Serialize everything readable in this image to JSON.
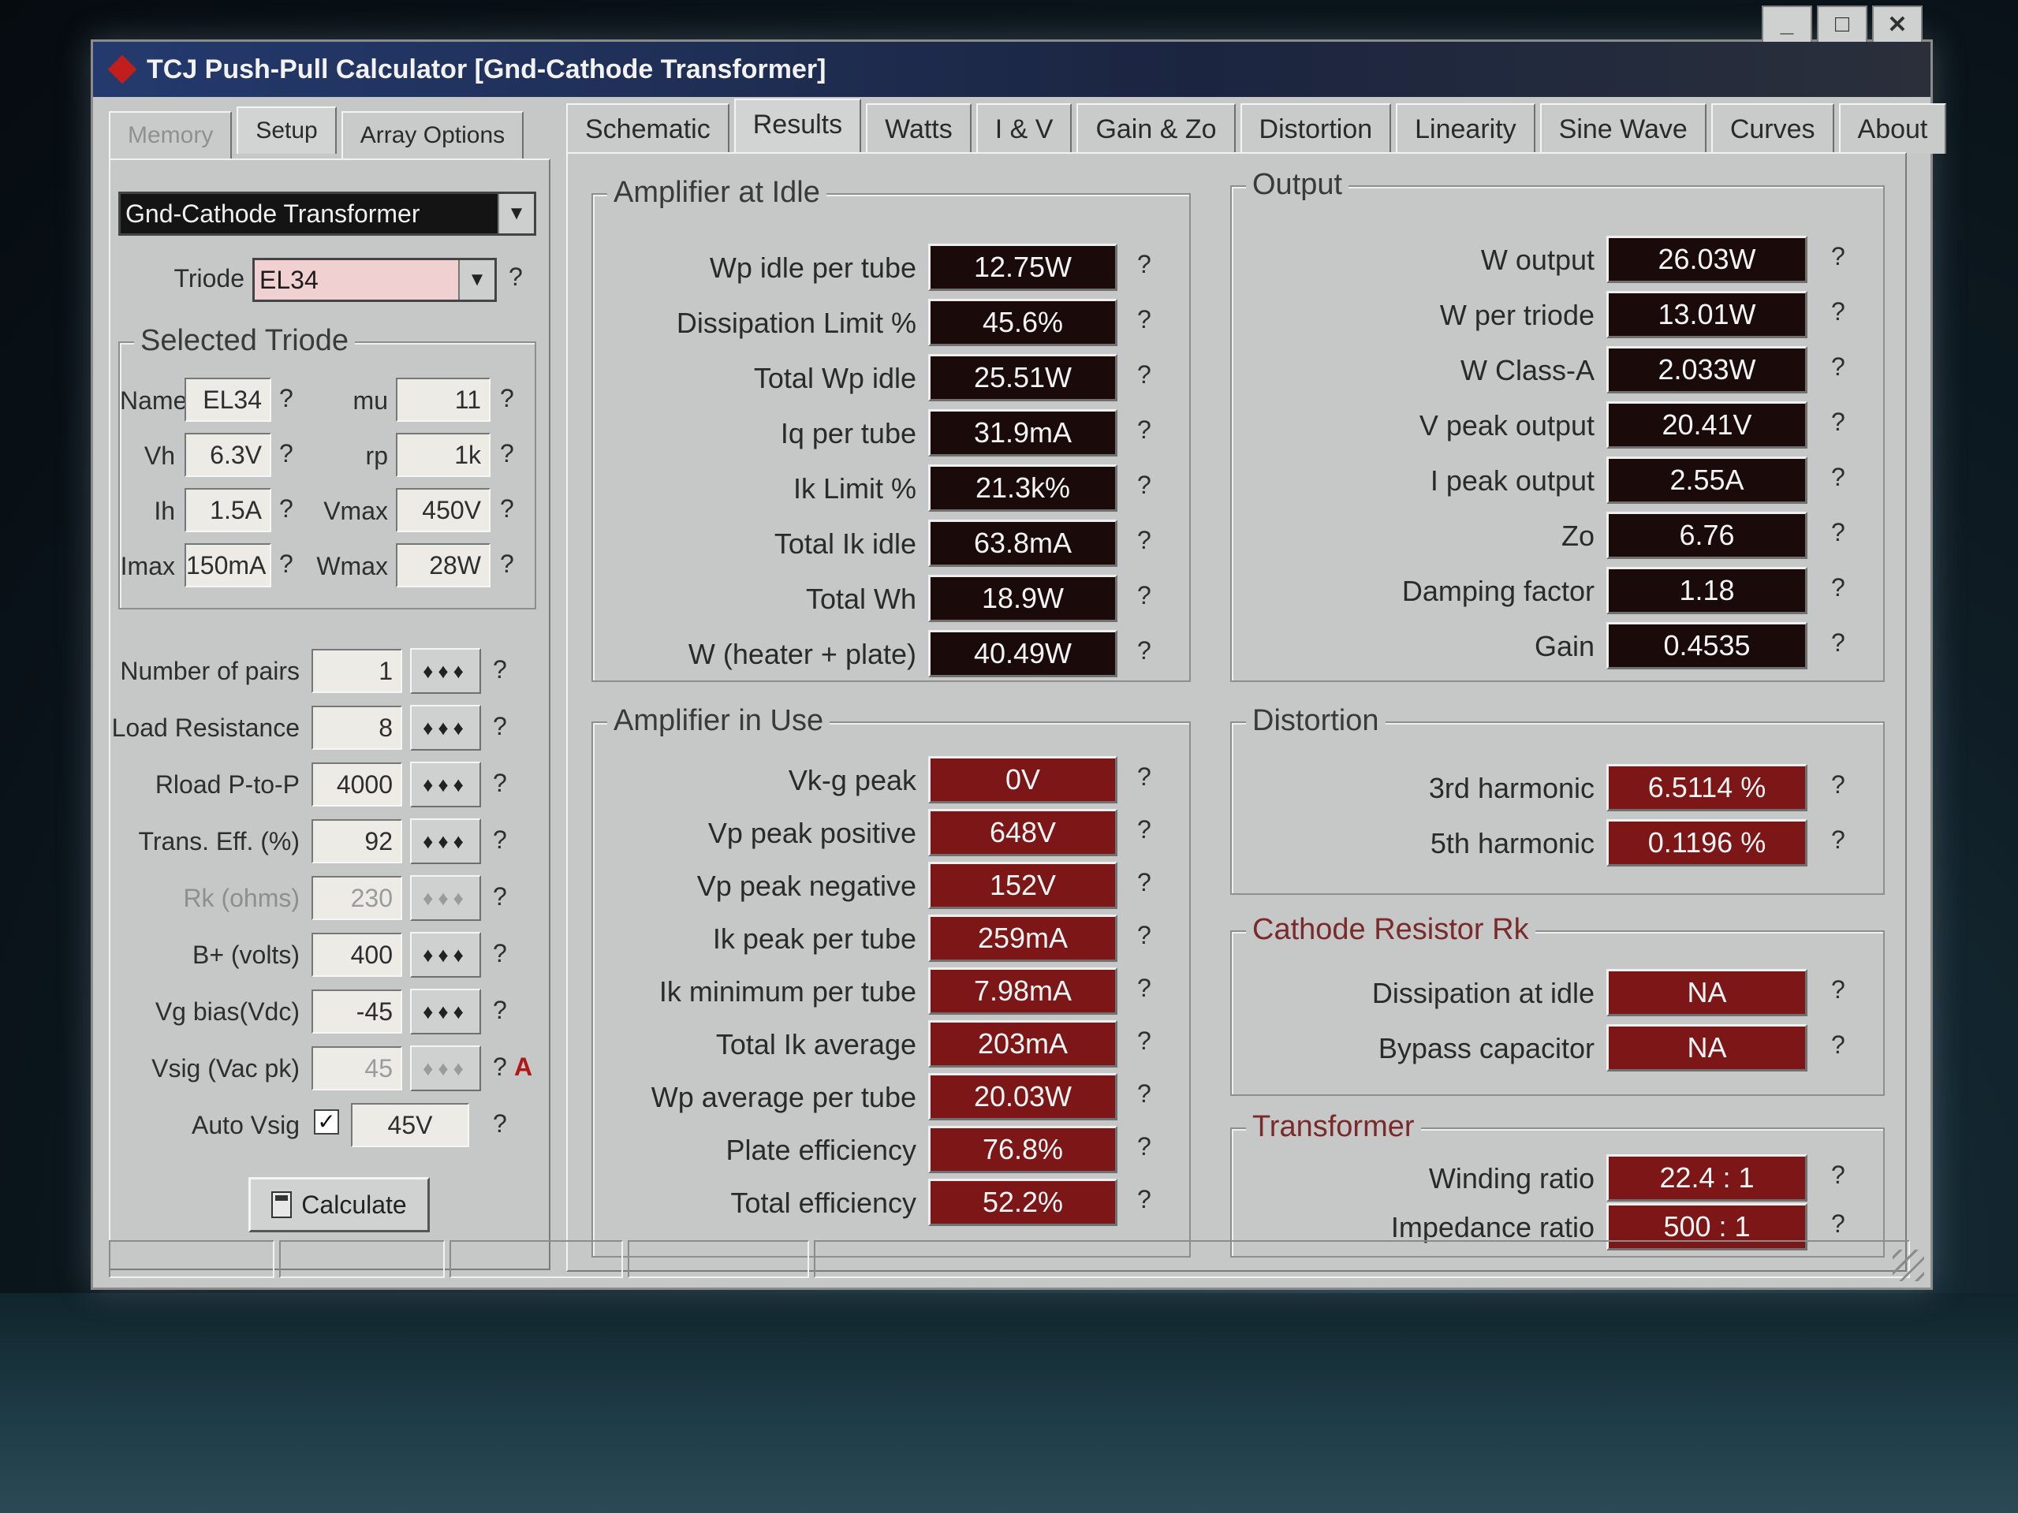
{
  "window": {
    "title": "TCJ Push-Pull Calculator [Gnd-Cathode Transformer]"
  },
  "left_tabs": [
    "Memory",
    "Setup",
    "Array Options"
  ],
  "right_tabs": [
    "Schematic",
    "Results",
    "Watts",
    "I & V",
    "Gain & Zo",
    "Distortion",
    "Linearity",
    "Sine Wave",
    "Curves",
    "About"
  ],
  "setup": {
    "topology": "Gnd-Cathode Transformer",
    "triode_label": "Triode",
    "triode": "EL34",
    "selected_triode": {
      "title": "Selected Triode",
      "name_label": "Name",
      "name": "EL34",
      "vh_label": "Vh",
      "vh": "6.3V",
      "ih_label": "Ih",
      "ih": "1.5A",
      "imax_label": "Imax",
      "imax": "150mA",
      "mu_label": "mu",
      "mu": "11",
      "rp_label": "rp",
      "rp": "1k",
      "vmax_label": "Vmax",
      "vmax": "450V",
      "wmax_label": "Wmax",
      "wmax": "28W"
    },
    "params": [
      {
        "label": "Number of pairs",
        "value": "1"
      },
      {
        "label": "Load Resistance",
        "value": "8"
      },
      {
        "label": "Rload P-to-P",
        "value": "4000"
      },
      {
        "label": "Trans. Eff. (%)",
        "value": "92"
      },
      {
        "label": "Rk (ohms)",
        "value": "230"
      },
      {
        "label": "B+ (volts)",
        "value": "400"
      },
      {
        "label": "Vg bias(Vdc)",
        "value": "-45"
      },
      {
        "label": "Vsig (Vac pk)",
        "value": "45"
      }
    ],
    "auto_vsig_label": "Auto Vsig",
    "auto_vsig_value": "45V",
    "a_marker": "A",
    "calculate_label": "Calculate",
    "help_mark": "?"
  },
  "idle": {
    "title": "Amplifier at Idle",
    "rows": [
      {
        "label": "Wp idle per tube",
        "value": "12.75W"
      },
      {
        "label": "Dissipation Limit %",
        "value": "45.6%"
      },
      {
        "label": "Total Wp idle",
        "value": "25.51W"
      },
      {
        "label": "Iq per tube",
        "value": "31.9mA"
      },
      {
        "label": "Ik Limit %",
        "value": "21.3k%"
      },
      {
        "label": "Total Ik idle",
        "value": "63.8mA"
      },
      {
        "label": "Total Wh",
        "value": "18.9W"
      },
      {
        "label": "W (heater + plate)",
        "value": "40.49W"
      }
    ]
  },
  "in_use": {
    "title": "Amplifier in Use",
    "rows": [
      {
        "label": "Vk-g peak",
        "value": "0V"
      },
      {
        "label": "Vp peak positive",
        "value": "648V"
      },
      {
        "label": "Vp peak negative",
        "value": "152V"
      },
      {
        "label": "Ik peak per tube",
        "value": "259mA"
      },
      {
        "label": "Ik minimum per tube",
        "value": "7.98mA"
      },
      {
        "label": "Total Ik average",
        "value": "203mA"
      },
      {
        "label": "Wp average per tube",
        "value": "20.03W"
      },
      {
        "label": "Plate efficiency",
        "value": "76.8%"
      },
      {
        "label": "Total efficiency",
        "value": "52.2%"
      }
    ]
  },
  "output": {
    "title": "Output",
    "rows": [
      {
        "label": "W output",
        "value": "26.03W"
      },
      {
        "label": "W per triode",
        "value": "13.01W"
      },
      {
        "label": "W Class-A",
        "value": "2.033W"
      },
      {
        "label": "V peak output",
        "value": "20.41V"
      },
      {
        "label": "I peak output",
        "value": "2.55A"
      },
      {
        "label": "Zo",
        "value": "6.76"
      },
      {
        "label": "Damping factor",
        "value": "1.18"
      },
      {
        "label": "Gain",
        "value": "0.4535"
      }
    ]
  },
  "distortion": {
    "title": "Distortion",
    "rows": [
      {
        "label": "3rd harmonic",
        "value": "6.5114 %"
      },
      {
        "label": "5th harmonic",
        "value": "0.1196 %"
      }
    ]
  },
  "cathode": {
    "title": "Cathode Resistor Rk",
    "rows": [
      {
        "label": "Dissipation at idle",
        "value": "NA"
      },
      {
        "label": "Bypass capacitor",
        "value": "NA"
      }
    ]
  },
  "transformer": {
    "title": "Transformer",
    "rows": [
      {
        "label": "Winding ratio",
        "value": "22.4 : 1"
      },
      {
        "label": "Impedance ratio",
        "value": "500 : 1"
      }
    ]
  },
  "colors": {
    "value_dark": "#1a0a0a",
    "value_red": "#7d1616",
    "face": "#c6c8c8"
  }
}
